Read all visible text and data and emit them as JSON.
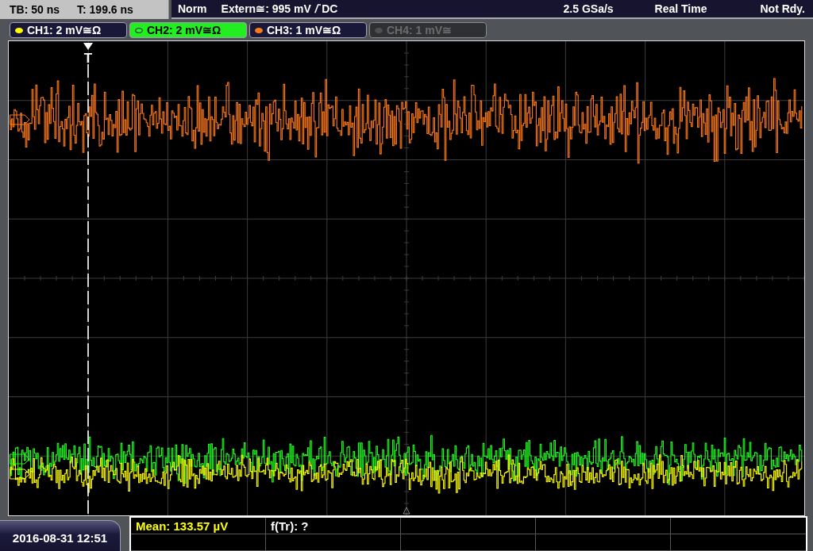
{
  "header": {
    "timebase": "TB: 50 ns",
    "trigger_time": "T: 199.6 ns"
  },
  "trigger": {
    "mode": "Norm",
    "source": "Extern≅: 995 mV",
    "edge": {
      "kind": "rising"
    },
    "coupling": "DC",
    "marker": "T"
  },
  "acquisition": {
    "sample_rate": "2.5 GSa/s",
    "mode": "Real Time",
    "status": "Not Rdy."
  },
  "channels": [
    {
      "label": "CH1: 2 mV≅Ω",
      "color": "#ffff00",
      "selected": false,
      "enabled": true
    },
    {
      "label": "CH2: 2 mV≅Ω",
      "color": "#22ff22",
      "selected": true,
      "enabled": true
    },
    {
      "label": "CH3: 1 mV≅Ω",
      "color": "#ff7a1a",
      "selected": false,
      "enabled": true
    },
    {
      "label": "CH4: 1 mV≅",
      "color": "#505050",
      "selected": false,
      "enabled": false
    }
  ],
  "measurements": [
    {
      "text": "Mean: 133.57 µV",
      "source": {
        "kind": "ch1"
      }
    },
    {
      "text": "f(Tr): ?",
      "source": {
        "kind": "trigger"
      }
    }
  ],
  "datetime": "2016-08-31 12:51"
}
